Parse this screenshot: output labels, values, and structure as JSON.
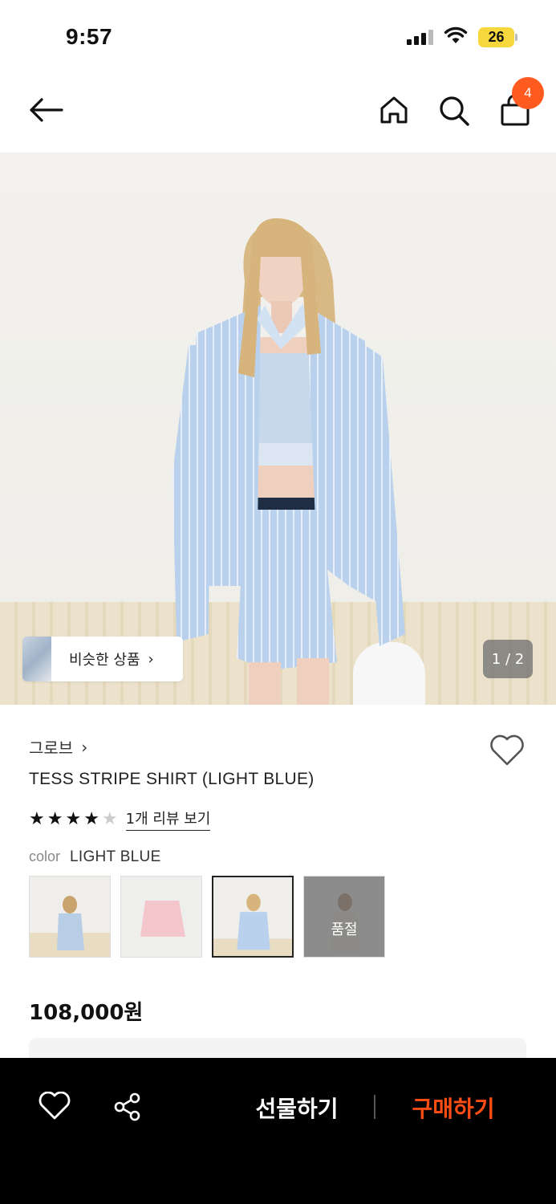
{
  "status_bar": {
    "time": "9:57",
    "battery": "26"
  },
  "header": {
    "cart_count": "4"
  },
  "gallery": {
    "similar_label": "비슷한 상품",
    "counter": "1 / 2"
  },
  "product": {
    "brand": "그로브",
    "name": "TESS STRIPE SHIRT (LIGHT BLUE)",
    "rating": 4,
    "review_link": "1개 리뷰 보기",
    "color_key": "color",
    "color_value": "LIGHT BLUE",
    "soldout_label": "품절",
    "price": "108,000원"
  },
  "bottom_bar": {
    "gift_label": "선물하기",
    "buy_label": "구매하기"
  },
  "colors": {
    "accent": "#ff4d14",
    "badge": "#ff5a1f"
  }
}
